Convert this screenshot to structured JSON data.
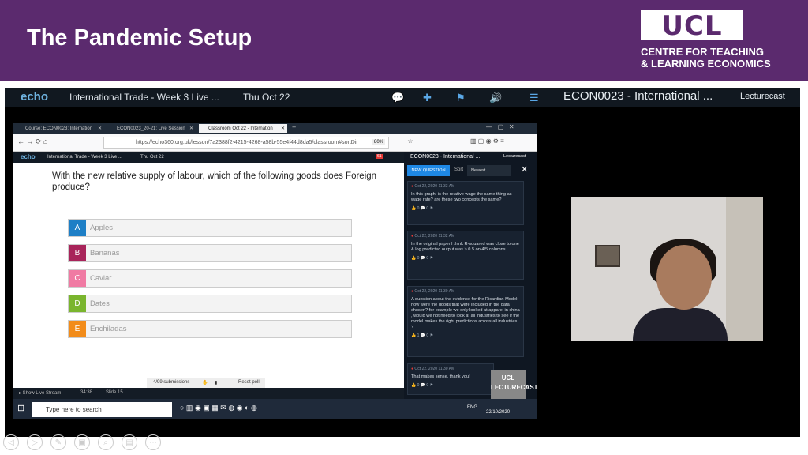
{
  "slide": {
    "title": "The Pandemic Setup"
  },
  "logo": {
    "text": "UCL",
    "subtitle_line1": "CENTRE FOR TEACHING",
    "subtitle_line2": "& LEARNING ECONOMICS"
  },
  "echo_bar": {
    "logo": "echo",
    "lecture": "International Trade - Week 3 Live ...",
    "date": "Thu Oct 22",
    "course": "ECON0023 - International ...",
    "lecturecast": "Lecturecast"
  },
  "browser": {
    "tabs": [
      {
        "label": "Course: ECON0023: Internation",
        "close": "✕"
      },
      {
        "label": "ECON0023_20-21: Live Session",
        "close": "✕"
      },
      {
        "label": "Classroom Oct 22 - Internation",
        "close": "✕"
      }
    ],
    "new_tab": "+",
    "url": "https://echo360.org.uk/lesson/7a2388f2-4215-4268-a58b-55e4f44d8da5/classroom#sortDir",
    "zoom": "80%",
    "inner_echo": {
      "logo": "echo",
      "lecture": "International Trade - Week 3 Live ...",
      "date": "Thu Oct 22",
      "badge": "61"
    },
    "question": "With the new relative supply of labour, which of the following goods does Foreign produce?",
    "options": [
      {
        "letter": "A",
        "label": "Apples",
        "color": "#1e7fc6"
      },
      {
        "letter": "B",
        "label": "Bananas",
        "color": "#a8245a"
      },
      {
        "letter": "C",
        "label": "Caviar",
        "color": "#f07aa3"
      },
      {
        "letter": "D",
        "label": "Dates",
        "color": "#7ab52e"
      },
      {
        "letter": "E",
        "label": "Enchiladas",
        "color": "#f28c1a"
      }
    ],
    "submissions": "4/99 submissions",
    "reset": "Reset poll",
    "live_stream": "▸ Show Live Stream",
    "time": "34:38",
    "slide_num": "Slide 15",
    "taskbar": {
      "search_placeholder": "Type here to search",
      "lang": "ENG",
      "date": "22/10/2020"
    },
    "qa": {
      "course": "ECON0023 - International ...",
      "lecturecast": "Lecturecast",
      "new_question": "NEW QUESTION",
      "sort_label": "Sort",
      "sort_value": "Newest",
      "cards": [
        {
          "ts": "Oct 22, 2020 11:33 AM",
          "text": "In this graph, is the relative wage the same thing as wage rate? are these two concepts the same?",
          "meta": "👍 0   💬 0   ⚑"
        },
        {
          "ts": "Oct 22, 2020 11:32 AM",
          "text": "In the original paper I think R-squared was close to one & log predicted output was > 0.5 on 4/5 columns",
          "meta": "👍 0   💬 0   ⚑"
        },
        {
          "ts": "Oct 22, 2020 11:30 AM",
          "text": "A question about the evidence for the Ricardian Model: how were the goods that were included in the data chosen? for example we only looked at apparel in china , would we not need to look at all industries to see if the model makes the right predictions across all industries ?",
          "meta": "👍 1   💬 0   ⚑"
        },
        {
          "ts": "Oct 22, 2020 11:30 AM",
          "text": "That makes sense, thank you!",
          "meta": "👍 0   💬 0   ⚑"
        }
      ],
      "watermark": "UCL LECTURECAST"
    }
  }
}
